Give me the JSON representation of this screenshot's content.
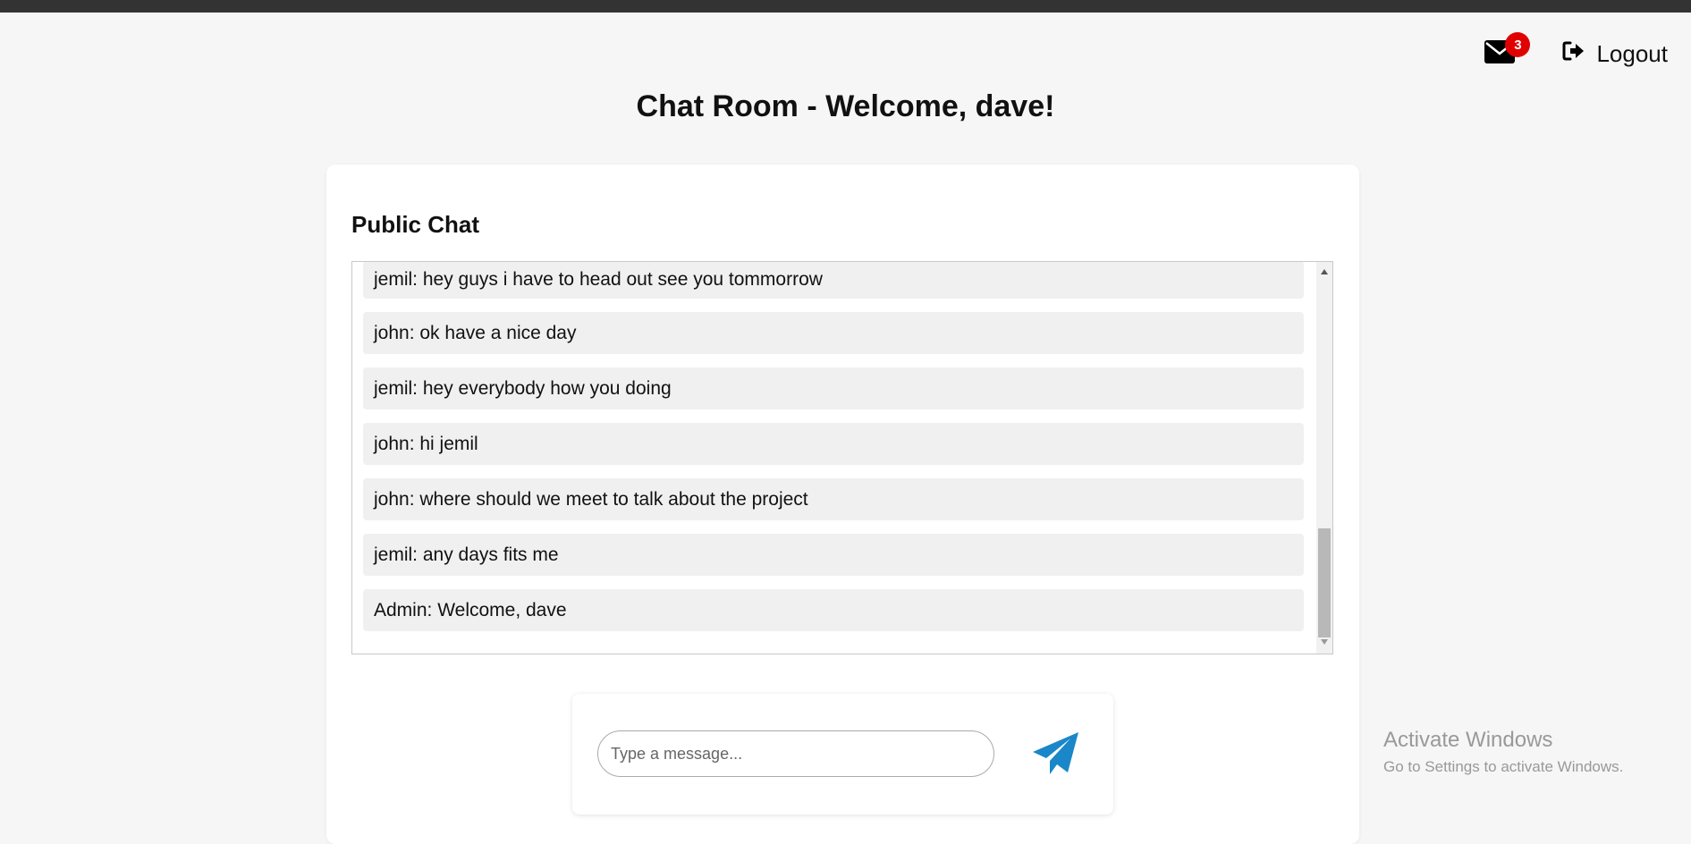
{
  "header": {
    "mail_icon": "envelope-icon",
    "unread_count": "3",
    "logout_icon": "sign-out-icon",
    "logout_label": "Logout"
  },
  "page": {
    "title": "Chat Room - Welcome, dave!"
  },
  "chat": {
    "title": "Public Chat",
    "messages": [
      "jemil: hey guys i have to head out see you tommorrow",
      "john: ok have a nice day",
      "jemil: hey everybody how you doing",
      "john: hi jemil",
      "john: where should we meet to talk about the project",
      "jemil: any days fits me",
      "Admin: Welcome, dave"
    ]
  },
  "composer": {
    "placeholder": "Type a message...",
    "value": "",
    "send_icon": "paper-plane-icon"
  },
  "watermark": {
    "title": "Activate Windows",
    "subtitle": "Go to Settings to activate Windows."
  },
  "colors": {
    "background": "#f6f6f6",
    "topbar": "#333333",
    "badge": "#e00000",
    "send_icon": "#1a87c9",
    "message_bg": "#f0f0f0"
  }
}
